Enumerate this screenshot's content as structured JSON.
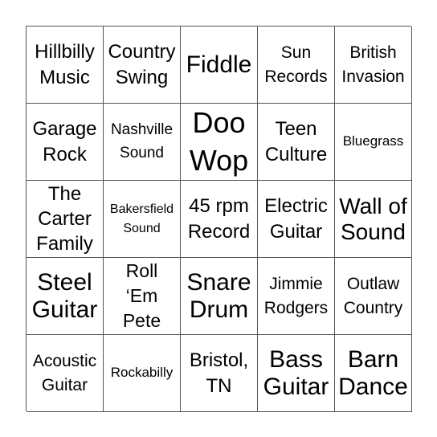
{
  "board": {
    "rows": [
      [
        {
          "text": "Hillbilly\nMusic",
          "size": "s-md"
        },
        {
          "text": "Country\nSwing",
          "size": "s-md"
        },
        {
          "text": "Fiddle",
          "size": "s-lg"
        },
        {
          "text": "Sun\nRecords",
          "size": "s-sm"
        },
        {
          "text": "British\nInvasion",
          "size": "s-sm"
        }
      ],
      [
        {
          "text": "Garage\nRock",
          "size": "s-md"
        },
        {
          "text": "Nashville\nSound",
          "size": "s-xs"
        },
        {
          "text": "Doo\nWop",
          "size": "s-xl"
        },
        {
          "text": "Teen\nCulture",
          "size": "s-md"
        },
        {
          "text": "Bluegrass",
          "size": "s-xxs"
        }
      ],
      [
        {
          "text": "The\nCarter\nFamily",
          "size": "s-md"
        },
        {
          "text": "Bakersfield\nSound",
          "size": "s-tiny"
        },
        {
          "text": "45 rpm\nRecord",
          "size": "s-md"
        },
        {
          "text": "Electric\nGuitar",
          "size": "s-md"
        },
        {
          "text": "Wall of\nSound",
          "size": "s-ml"
        }
      ],
      [
        {
          "text": "Steel\nGuitar",
          "size": "s-lg"
        },
        {
          "text": "Roll\n‘Em\nPete",
          "size": "s-m2"
        },
        {
          "text": "Snare\nDrum",
          "size": "s-lg"
        },
        {
          "text": "Jimmie\nRodgers",
          "size": "s-sm"
        },
        {
          "text": "Outlaw\nCountry",
          "size": "s-sm"
        }
      ],
      [
        {
          "text": "Acoustic\nGuitar",
          "size": "s-sm"
        },
        {
          "text": "Rockabilly",
          "size": "s-xxs"
        },
        {
          "text": "Bristol,\nTN",
          "size": "s-md"
        },
        {
          "text": "Bass\nGuitar",
          "size": "s-lg"
        },
        {
          "text": "Barn\nDance",
          "size": "s-lg"
        }
      ]
    ]
  }
}
